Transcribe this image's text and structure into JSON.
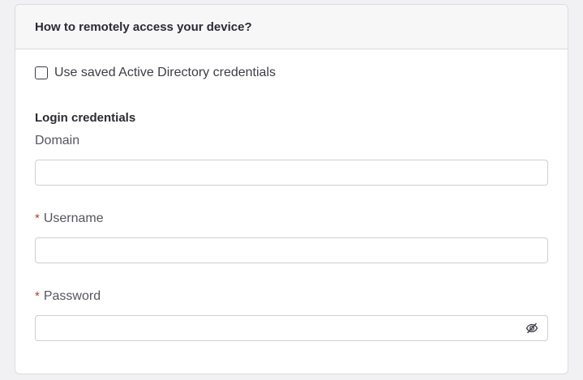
{
  "header": {
    "title": "How to remotely access your device?"
  },
  "use_saved": {
    "label": "Use saved Active Directory credentials",
    "checked": false
  },
  "login": {
    "section_title": "Login credentials",
    "domain": {
      "label": "Domain",
      "value": ""
    },
    "username": {
      "label": "Username",
      "required_mark": "*",
      "value": ""
    },
    "password": {
      "label": "Password",
      "required_mark": "*",
      "value": "",
      "toggle_icon": "eye-slash-icon"
    }
  }
}
